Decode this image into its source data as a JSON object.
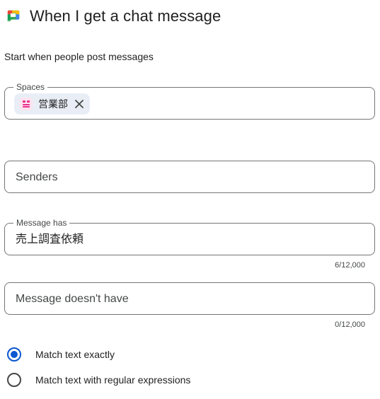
{
  "header": {
    "title": "When I get a chat message",
    "logo_icon": "google-chat-icon"
  },
  "subtitle": "Start when people post messages",
  "spaces_field": {
    "label": "Spaces",
    "chip": {
      "label": "営業部",
      "icon": "space-icon",
      "close_icon": "close-icon"
    }
  },
  "senders_field": {
    "placeholder": "Senders"
  },
  "message_has_field": {
    "label": "Message has",
    "value": "売上調査依頼",
    "counter": "6/12,000"
  },
  "message_doesnt_have_field": {
    "placeholder": "Message doesn't have",
    "counter": "0/12,000"
  },
  "match_options": [
    {
      "label": "Match text exactly",
      "selected": true
    },
    {
      "label": "Match text with regular expressions",
      "selected": false
    }
  ],
  "colors": {
    "accent": "#0b57d0",
    "chip_bg": "#e9eef6",
    "space_icon": "#e8308c",
    "border": "#747775"
  }
}
